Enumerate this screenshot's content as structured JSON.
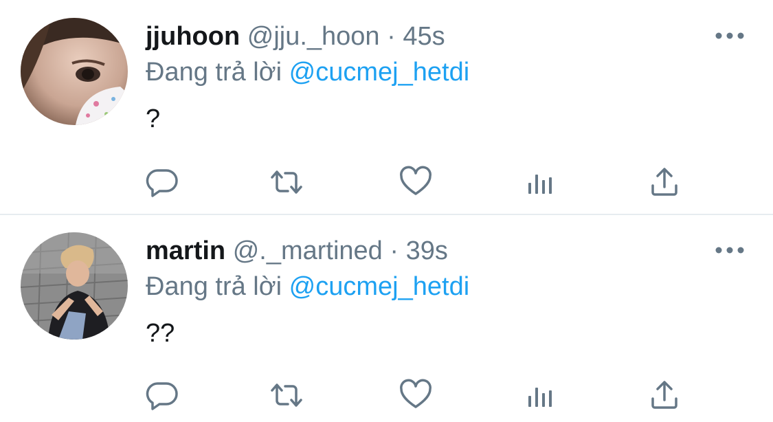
{
  "colors": {
    "name": "#14171a",
    "muted": "#657786",
    "mention": "#1da1f2",
    "divider": "#e6ecf0",
    "icon": "#657786"
  },
  "tweets": [
    {
      "name": "jjuhoon",
      "handle": "@jju._hoon",
      "separator": "·",
      "time": "45s",
      "reply_prefix": "Đang trả lời",
      "reply_to": "@cucmej_hetdi",
      "text": "?"
    },
    {
      "name": "martin",
      "handle": "@._martined",
      "separator": "·",
      "time": "39s",
      "reply_prefix": "Đang trả lời",
      "reply_to": "@cucmej_hetdi",
      "text": "??"
    }
  ],
  "icons": {
    "reply": "speech-bubble-icon",
    "retweet": "retweet-arrows-icon",
    "like": "heart-icon",
    "stats": "bar-chart-icon",
    "share": "share-upload-icon",
    "more": "ellipsis-icon"
  }
}
